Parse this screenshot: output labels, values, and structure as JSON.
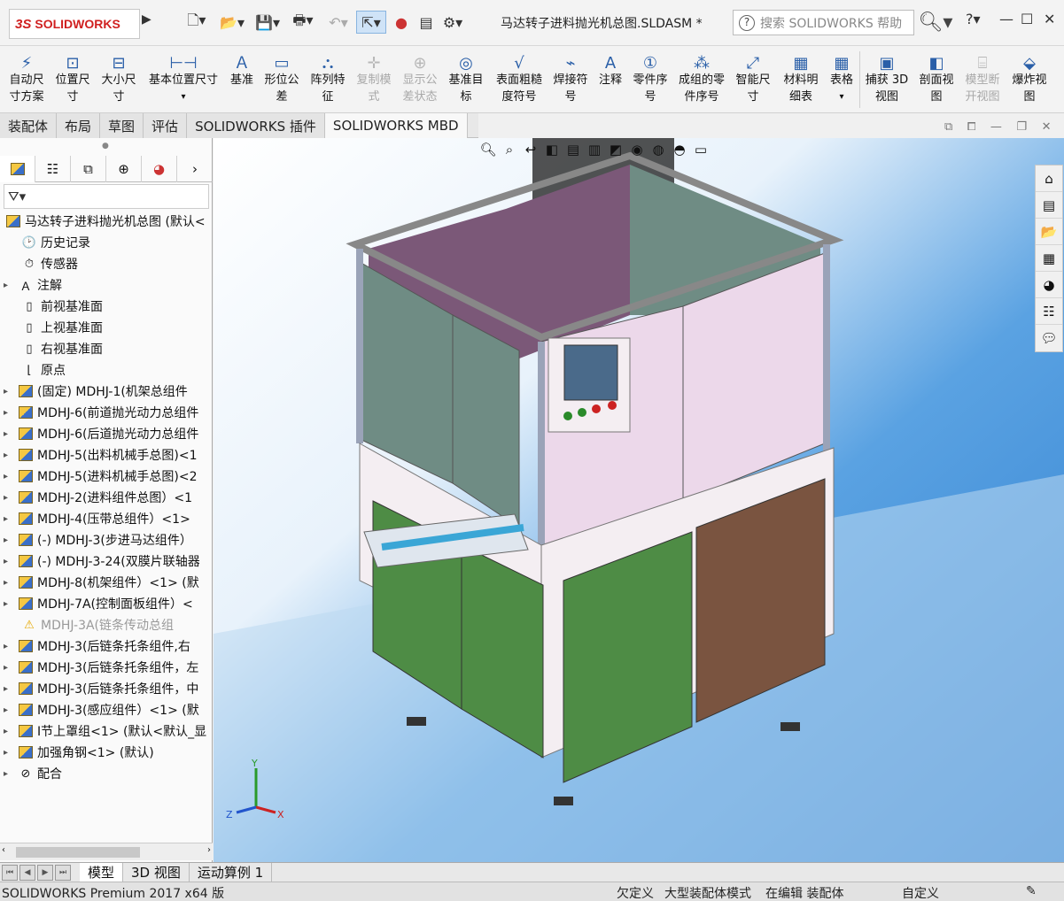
{
  "app": {
    "logo_prefix": "3S",
    "logo_text": "SOLIDWORKS",
    "document_title": "马达转子进料抛光机总图.SLDASM *"
  },
  "search": {
    "placeholder": "搜索 SOLIDWORKS 帮助",
    "icon": "search-icon",
    "help_icon": "question-icon"
  },
  "quick_access": [
    "new-document-icon",
    "open-folder-icon",
    "save-icon",
    "print-icon",
    "undo-icon",
    "select-arrow-icon",
    "rebuild-light-icon",
    "file-properties-icon",
    "options-gear-icon"
  ],
  "window_controls": [
    "?",
    "—",
    "☐",
    "✕"
  ],
  "toolbar": [
    {
      "line1": "自动尺",
      "line2": "寸方案",
      "icon": "auto-dimension-icon",
      "enabled": true
    },
    {
      "line1": "位置尺",
      "line2": "寸",
      "icon": "location-dimension-icon",
      "enabled": true
    },
    {
      "line1": "大小尺",
      "line2": "寸",
      "icon": "size-dimension-icon",
      "enabled": true
    },
    {
      "line1": "基本位置尺寸",
      "line2": "",
      "icon": "basic-location-dimension-icon",
      "enabled": true
    },
    {
      "line1": "基准",
      "line2": "",
      "icon": "datum-icon",
      "enabled": true
    },
    {
      "line1": "形位公",
      "line2": "差",
      "icon": "geometric-tolerance-icon",
      "enabled": true
    },
    {
      "line1": "阵列特",
      "line2": "征",
      "icon": "pattern-feature-icon",
      "enabled": true
    },
    {
      "line1": "复制模",
      "line2": "式",
      "icon": "copy-scheme-icon",
      "enabled": false
    },
    {
      "line1": "显示公",
      "line2": "差状态",
      "icon": "show-tolerance-status-icon",
      "enabled": false
    },
    {
      "line1": "基准目",
      "line2": "标",
      "icon": "datum-target-icon",
      "enabled": true
    },
    {
      "line1": "表面粗糙",
      "line2": "度符号",
      "icon": "surface-finish-icon",
      "enabled": true
    },
    {
      "line1": "焊接符",
      "line2": "号",
      "icon": "weld-symbol-icon",
      "enabled": true
    },
    {
      "line1": "注释",
      "line2": "",
      "icon": "note-icon",
      "enabled": true
    },
    {
      "line1": "零件序",
      "line2": "号",
      "icon": "balloon-icon",
      "enabled": true
    },
    {
      "line1": "成组的零",
      "line2": "件序号",
      "icon": "stacked-balloon-icon",
      "enabled": true
    },
    {
      "line1": "智能尺",
      "line2": "寸",
      "icon": "smart-dimension-icon",
      "enabled": true
    },
    {
      "line1": "材料明",
      "line2": "细表",
      "icon": "bill-of-materials-icon",
      "enabled": true
    },
    {
      "line1": "表格",
      "line2": "",
      "icon": "table-icon",
      "enabled": true
    },
    {
      "line1": "捕获 3D",
      "line2": "视图",
      "icon": "capture-3d-view-icon",
      "enabled": true
    },
    {
      "line1": "剖面视",
      "line2": "图",
      "icon": "section-view-icon",
      "enabled": true
    },
    {
      "line1": "模型断",
      "line2": "开视图",
      "icon": "model-break-view-icon",
      "enabled": false
    },
    {
      "line1": "爆炸视",
      "line2": "图",
      "icon": "explode-view-icon",
      "enabled": true
    }
  ],
  "tabs": [
    "装配体",
    "布局",
    "草图",
    "评估",
    "SOLIDWORKS 插件",
    "SOLIDWORKS MBD"
  ],
  "active_tab": "SOLIDWORKS MBD",
  "tree": [
    {
      "label": "马达转子进料抛光机总图 (默认<",
      "type": "root",
      "arrow": false
    },
    {
      "label": "历史记录",
      "type": "history",
      "arrow": false
    },
    {
      "label": "传感器",
      "type": "sensor",
      "arrow": false
    },
    {
      "label": "注解",
      "type": "annotation",
      "arrow": true
    },
    {
      "label": "前视基准面",
      "type": "plane",
      "arrow": false
    },
    {
      "label": "上视基准面",
      "type": "plane",
      "arrow": false
    },
    {
      "label": "右视基准面",
      "type": "plane",
      "arrow": false
    },
    {
      "label": "原点",
      "type": "origin",
      "arrow": false
    },
    {
      "label": "(固定) MDHJ-1(机架总组件",
      "type": "asm",
      "arrow": true
    },
    {
      "label": "MDHJ-6(前道抛光动力总组件",
      "type": "asm",
      "arrow": true
    },
    {
      "label": "MDHJ-6(后道抛光动力总组件",
      "type": "asm",
      "arrow": true
    },
    {
      "label": "MDHJ-5(出料机械手总图)<1",
      "type": "asm",
      "arrow": true
    },
    {
      "label": "MDHJ-5(进料机械手总图)<2",
      "type": "asm",
      "arrow": true
    },
    {
      "label": "MDHJ-2(进料组件总图）<1",
      "type": "asm",
      "arrow": true
    },
    {
      "label": "MDHJ-4(压带总组件）<1>",
      "type": "asm",
      "arrow": true
    },
    {
      "label": "(-) MDHJ-3(步进马达组件）",
      "type": "asm",
      "arrow": true
    },
    {
      "label": "(-) MDHJ-3-24(双膜片联轴器",
      "type": "asm",
      "arrow": true
    },
    {
      "label": "MDHJ-8(机架组件）<1> (默",
      "type": "asm",
      "arrow": true
    },
    {
      "label": "MDHJ-7A(控制面板组件）<",
      "type": "asm",
      "arrow": true
    },
    {
      "label": "MDHJ-3A(链条传动总组",
      "type": "warn",
      "arrow": false
    },
    {
      "label": "MDHJ-3(后链条托条组件,右",
      "type": "asm",
      "arrow": true
    },
    {
      "label": "MDHJ-3(后链条托条组件，左",
      "type": "asm",
      "arrow": true
    },
    {
      "label": "MDHJ-3(后链条托条组件，中",
      "type": "asm",
      "arrow": true
    },
    {
      "label": "MDHJ-3(感应组件）<1> (默",
      "type": "asm",
      "arrow": true
    },
    {
      "label": "I节上罩组<1> (默认<默认_显",
      "type": "asm",
      "arrow": true
    },
    {
      "label": "加强角钢<1> (默认)",
      "type": "asm",
      "arrow": true
    },
    {
      "label": "配合",
      "type": "mate",
      "arrow": true
    }
  ],
  "panel_tabs": [
    "featuremanager-tree-icon",
    "propertymanager-icon",
    "configurationmanager-icon",
    "dimxpert-icon",
    "display-manager-icon"
  ],
  "bottom_tabs": [
    "模型",
    "3D 视图",
    "运动算例 1"
  ],
  "active_bottom_tab": "模型",
  "status": {
    "product": "SOLIDWORKS Premium 2017 x64 版",
    "undefined": "欠定义",
    "large_assembly": "大型装配体模式",
    "editing": "在编辑 装配体",
    "custom": "自定义"
  },
  "axes": {
    "x": "X",
    "y": "Y",
    "z": "Z"
  },
  "colors": {
    "panel_green": "#4e8c45",
    "panel_brown": "#7a5440",
    "panel_purple": "#7b5878",
    "panel_teal": "#6f8c84",
    "frame_white": "#f4eef2",
    "background_blue": "#3b8ad6"
  },
  "heads_up": [
    "zoom-to-fit-icon",
    "zoom-area-icon",
    "previous-view-icon",
    "section-view-icon",
    "dynamic-annotation-icon",
    "view-orientation-icon",
    "display-style-icon",
    "hide-show-icon",
    "edit-appearance-icon",
    "apply-scene-icon",
    "view-settings-icon"
  ],
  "task_pane": [
    "home-icon",
    "design-library-icon",
    "file-explorer-icon",
    "view-palette-icon",
    "appearances-icon",
    "custom-properties-icon",
    "forum-icon"
  ]
}
